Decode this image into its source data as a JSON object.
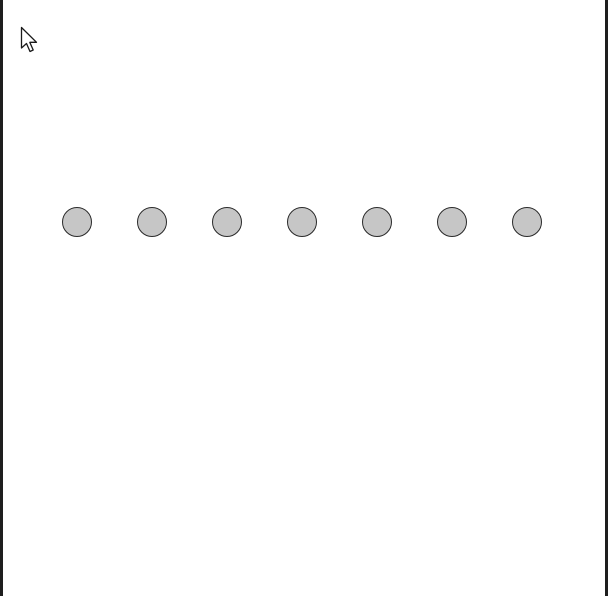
{
  "canvas": {
    "background": "#ffffff",
    "border_color": "#1e1e1e"
  },
  "pointer": {
    "icon": "mouse-pointer-arrow-icon"
  },
  "circles": {
    "count": 7,
    "fill": "#c6c6c6",
    "stroke": "#2a2a2a"
  }
}
